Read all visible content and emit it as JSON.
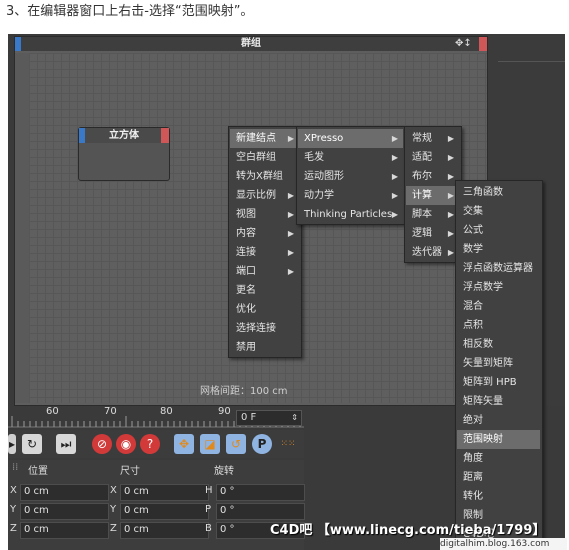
{
  "caption": "3、在编辑器窗口上右击-选择“范围映射”。",
  "editor": {
    "title": "群组",
    "grid_spacing": "网格间距：100 cm",
    "node": {
      "label": "立方体"
    }
  },
  "context_menu": {
    "items": [
      {
        "label": "新建结点",
        "submenu": true,
        "selected": true
      },
      {
        "label": "空白群组",
        "submenu": false
      },
      {
        "label": "转为X群组",
        "submenu": false
      },
      {
        "label": "显示比例",
        "submenu": true
      },
      {
        "label": "视图",
        "submenu": true
      },
      {
        "label": "内容",
        "submenu": true
      },
      {
        "label": "连接",
        "submenu": true
      },
      {
        "label": "端口",
        "submenu": true
      },
      {
        "label": "更名",
        "submenu": false
      },
      {
        "label": "优化",
        "submenu": false
      },
      {
        "label": "选择连接",
        "submenu": false
      },
      {
        "label": "禁用",
        "submenu": false
      }
    ]
  },
  "submenu_new_node": {
    "items": [
      {
        "label": "XPresso",
        "submenu": true,
        "selected": true
      },
      {
        "label": "毛发",
        "submenu": true
      },
      {
        "label": "运动图形",
        "submenu": true
      },
      {
        "label": "动力学",
        "submenu": true
      },
      {
        "label": "Thinking Particles",
        "submenu": true
      }
    ]
  },
  "submenu_xpresso": {
    "items": [
      {
        "label": "常规",
        "submenu": true
      },
      {
        "label": "适配",
        "submenu": true
      },
      {
        "label": "布尔",
        "submenu": true
      },
      {
        "label": "计算",
        "submenu": true,
        "selected": true
      },
      {
        "label": "脚本",
        "submenu": true
      },
      {
        "label": "逻辑",
        "submenu": true
      },
      {
        "label": "迭代器",
        "submenu": true
      }
    ]
  },
  "submenu_calc": {
    "items": [
      {
        "label": "三角函数"
      },
      {
        "label": "交集"
      },
      {
        "label": "公式"
      },
      {
        "label": "数学"
      },
      {
        "label": "浮点函数运算器"
      },
      {
        "label": "浮点数学"
      },
      {
        "label": "混合"
      },
      {
        "label": "点积"
      },
      {
        "label": "相反数"
      },
      {
        "label": "矢量到矩阵"
      },
      {
        "label": "矩阵到 HPB"
      },
      {
        "label": "矩阵矢量"
      },
      {
        "label": "绝对"
      },
      {
        "label": "范围映射",
        "selected": true
      },
      {
        "label": "角度"
      },
      {
        "label": "距离"
      },
      {
        "label": "转化"
      },
      {
        "label": "限制"
      },
      {
        "label": "C4D吧"
      }
    ]
  },
  "timeline": {
    "ticks": [
      "60",
      "70",
      "80",
      "90"
    ],
    "frame": "0 F"
  },
  "coords": {
    "headers": {
      "position": "位置",
      "size": "尺寸",
      "rotation": "旋转"
    },
    "rows": [
      {
        "axis": "X",
        "pos": "0 cm",
        "size_axis": "X",
        "size": "0 cm",
        "rot_axis": "H",
        "rot": "0 °"
      },
      {
        "axis": "Y",
        "pos": "0 cm",
        "size_axis": "Y",
        "size": "0 cm",
        "rot_axis": "P",
        "rot": "0 °"
      },
      {
        "axis": "Z",
        "pos": "0 cm",
        "size_axis": "Z",
        "size": "0 cm",
        "rot_axis": "B",
        "rot": "0 °"
      }
    ]
  },
  "watermark": "C4D吧 【www.linecg.com/tieba/1799】",
  "corner_text": "digitalhim.blog.163.com",
  "colors": {
    "highlight": "#6c6c6c",
    "port_blue": "#3a79c8",
    "port_red": "#cf5757",
    "accent_orange": "#e08a1e"
  }
}
